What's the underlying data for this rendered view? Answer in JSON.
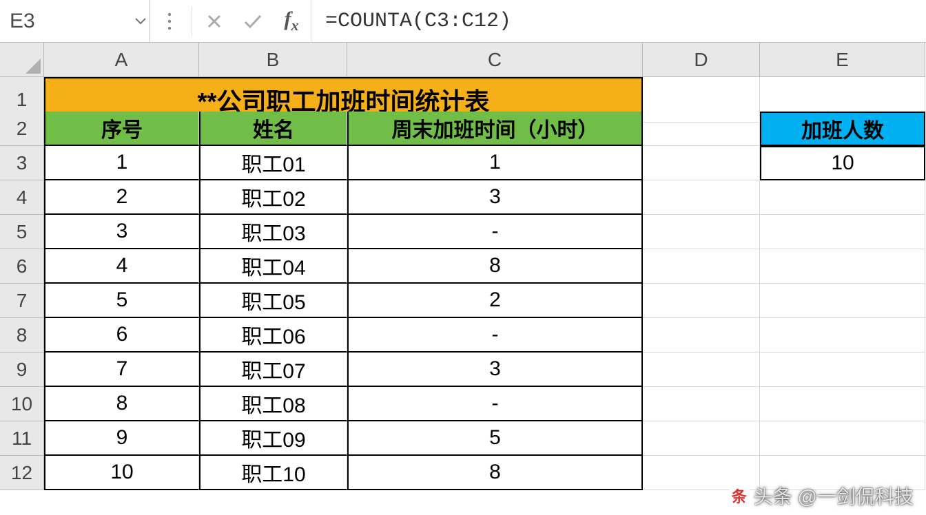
{
  "formula_bar": {
    "name_box": "E3",
    "formula": "=COUNTA(C3:C12)"
  },
  "columns": [
    "A",
    "B",
    "C",
    "D",
    "E"
  ],
  "row_numbers": [
    "1",
    "2",
    "3",
    "4",
    "5",
    "6",
    "7",
    "8",
    "9",
    "10",
    "11",
    "12"
  ],
  "title": "**公司职工加班时间统计表",
  "headers": {
    "a": "序号",
    "b": "姓名",
    "c": "周末加班时间（小时）"
  },
  "rows": [
    {
      "a": "1",
      "b": "职工01",
      "c": "1"
    },
    {
      "a": "2",
      "b": "职工02",
      "c": "3"
    },
    {
      "a": "3",
      "b": "职工03",
      "c": "-"
    },
    {
      "a": "4",
      "b": "职工04",
      "c": "8"
    },
    {
      "a": "5",
      "b": "职工05",
      "c": "2"
    },
    {
      "a": "6",
      "b": "职工06",
      "c": "-"
    },
    {
      "a": "7",
      "b": "职工07",
      "c": "3"
    },
    {
      "a": "8",
      "b": "职工08",
      "c": "-"
    },
    {
      "a": "9",
      "b": "职工09",
      "c": "5"
    },
    {
      "a": "10",
      "b": "职工10",
      "c": "8"
    }
  ],
  "side_header": "加班人数",
  "side_value": "10",
  "watermark": "头条 @一剑侃科技"
}
